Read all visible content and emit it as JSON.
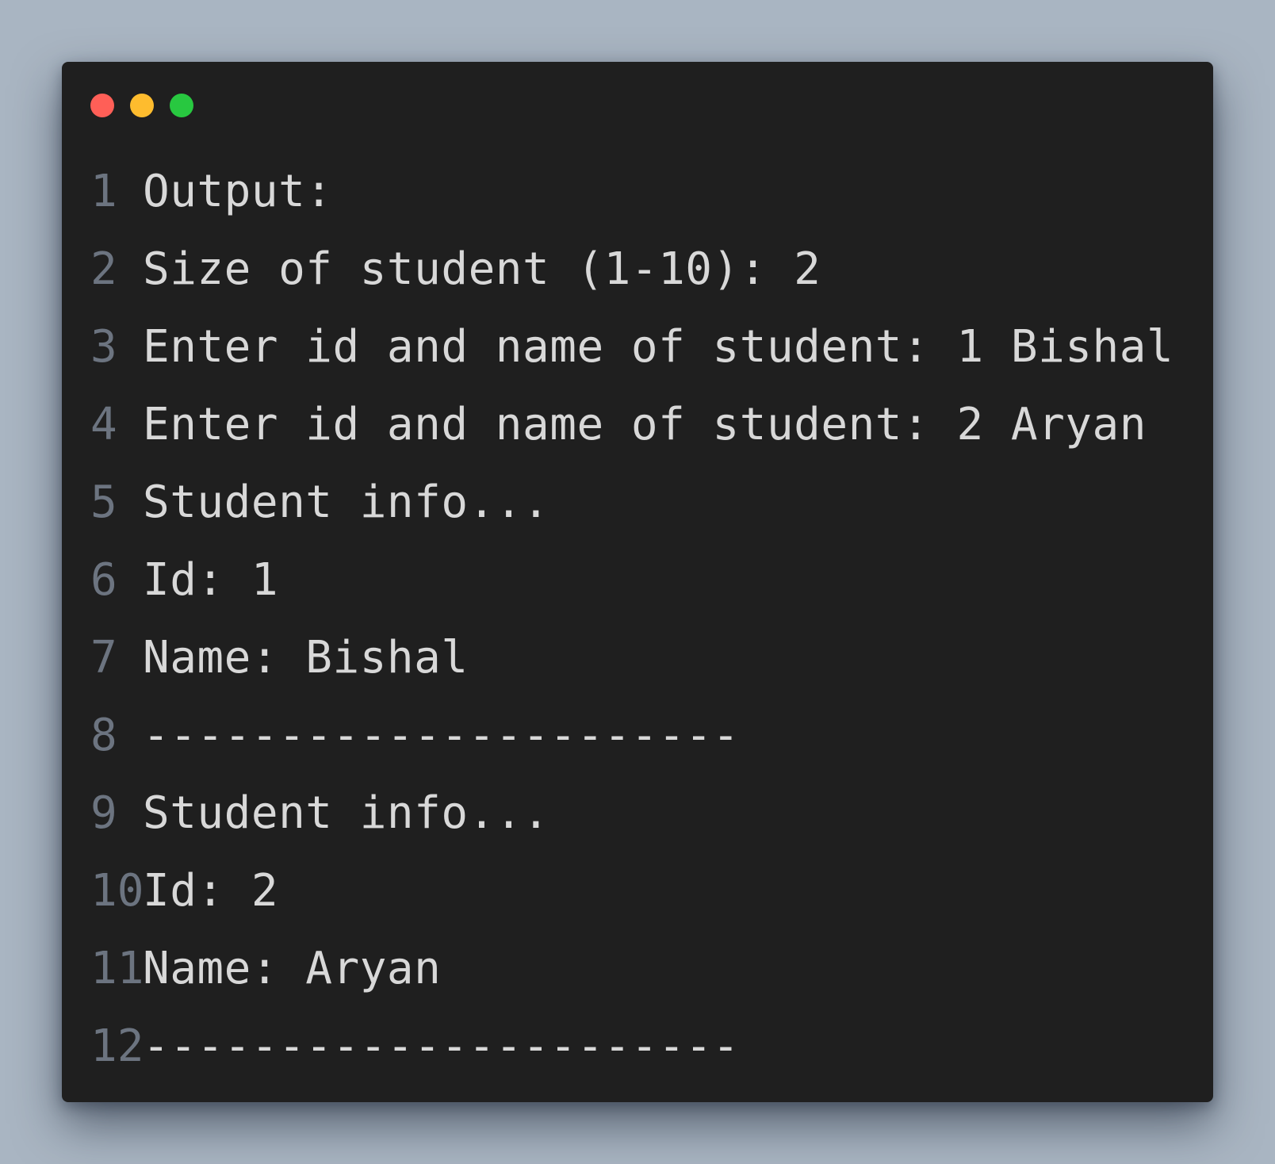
{
  "window": {
    "controls": {
      "close_color": "#ff5f57",
      "minimize_color": "#febc2e",
      "maximize_color": "#28c840"
    }
  },
  "code": {
    "lines": [
      {
        "number": "1",
        "text": "Output:"
      },
      {
        "number": "2",
        "text": "Size of student (1-10): 2"
      },
      {
        "number": "3",
        "text": "Enter id and name of student: 1 Bishal"
      },
      {
        "number": "4",
        "text": "Enter id and name of student: 2 Aryan"
      },
      {
        "number": "5",
        "text": "Student info..."
      },
      {
        "number": "6",
        "text": "Id: 1"
      },
      {
        "number": "7",
        "text": "Name: Bishal"
      },
      {
        "number": "8",
        "text": "----------------------"
      },
      {
        "number": "9",
        "text": "Student info..."
      },
      {
        "number": "10",
        "text": "Id: 2"
      },
      {
        "number": "11",
        "text": "Name: Aryan"
      },
      {
        "number": "12",
        "text": "----------------------"
      }
    ]
  }
}
